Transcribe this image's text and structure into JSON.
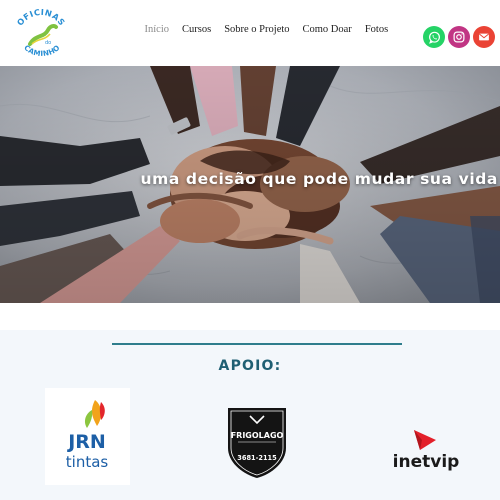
{
  "brand": {
    "logo_top": "OFICINAS",
    "logo_mid": "do",
    "logo_bottom": "CAMINHO"
  },
  "nav": {
    "items": [
      {
        "label": "Início",
        "active": true
      },
      {
        "label": "Cursos",
        "active": false
      },
      {
        "label": "Sobre o Projeto",
        "active": false
      },
      {
        "label": "Como Doar",
        "active": false
      },
      {
        "label": "Fotos",
        "active": false
      }
    ]
  },
  "social": [
    {
      "icon": "whatsapp-icon",
      "color": "#25d366"
    },
    {
      "icon": "instagram-icon",
      "color": "#c13584"
    },
    {
      "icon": "email-icon",
      "color": "#ea4335"
    }
  ],
  "hero": {
    "tagline": "uma decisão que pode mudar sua vida"
  },
  "apoio": {
    "title": "APOIO:",
    "accent_color": "#1f5f73",
    "sponsors": [
      {
        "name": "JRN tintas",
        "line1": "JRN",
        "line2": "tintas"
      },
      {
        "name": "FRIGOLAGO",
        "label": "FRIGOLAGO",
        "phone": "3681-2115"
      },
      {
        "name": "inetvip",
        "label": "inetvip"
      }
    ]
  }
}
